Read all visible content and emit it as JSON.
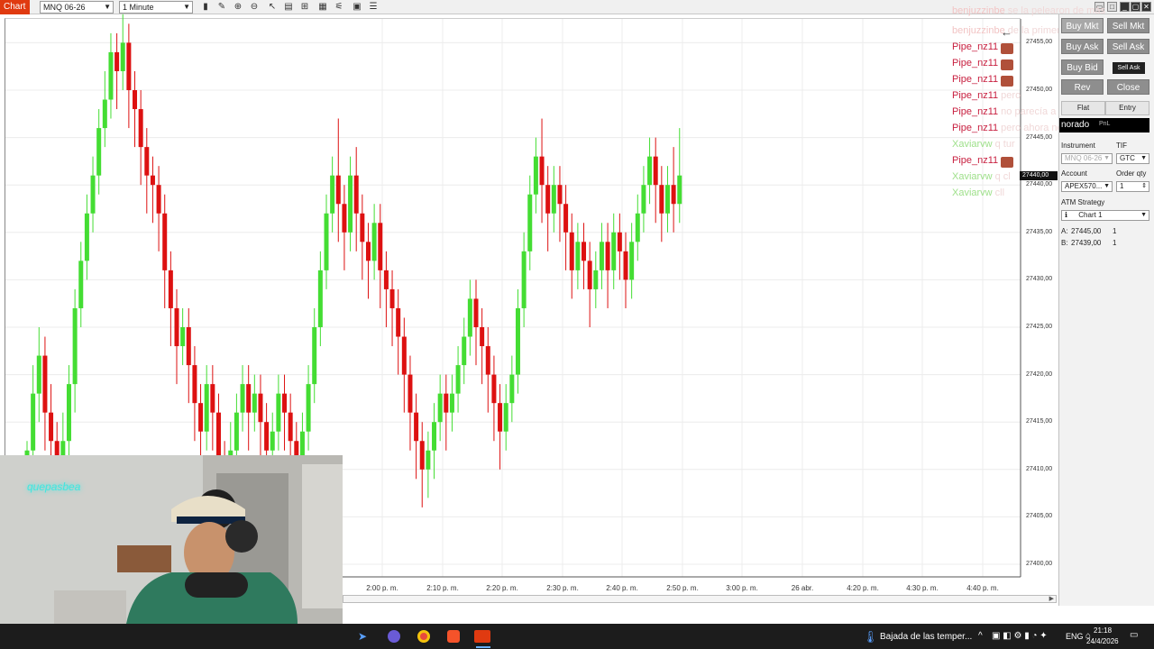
{
  "toolbar": {
    "tab": "Chart",
    "instrument": "MNQ 06-26",
    "interval": "1 Minute"
  },
  "price_axis": [
    "27455,00",
    "27450,00",
    "27445,00",
    "27440,00",
    "27435,00",
    "27430,00",
    "27425,00",
    "27420,00",
    "27415,00",
    "27410,00",
    "27405,00",
    "27400,00"
  ],
  "time_axis": [
    "2:00 p. m.",
    "2:10 p. m.",
    "2:20 p. m.",
    "2:30 p. m.",
    "2:40 p. m.",
    "2:50 p. m.",
    "3:00 p. m.",
    "26 abr.",
    "4:20 p. m.",
    "4:30 p. m.",
    "4:40 p. m."
  ],
  "price_tag": "27440,00",
  "chat": [
    {
      "user": "benjuzzinbe",
      "msg": "se la pelearon de más",
      "color": "#f2c4c4",
      "avatar": false
    },
    {
      "user": "benjuzzinbe",
      "msg": "de la primera de mierda",
      "color": "#f2c4c4",
      "avatar": false
    },
    {
      "user": "Pipe_nz11",
      "msg": "",
      "color": "#c82040",
      "avatar": true
    },
    {
      "user": "Pipe_nz11",
      "msg": "",
      "color": "#c82040",
      "avatar": true
    },
    {
      "user": "Pipe_nz11",
      "msg": "",
      "color": "#c82040",
      "avatar": true
    },
    {
      "user": "Pipe_nz11",
      "msg": "pero",
      "color": "#c82040",
      "avatar": false
    },
    {
      "user": "Pipe_nz11",
      "msg": "no parecía a ser",
      "color": "#c82040",
      "avatar": false
    },
    {
      "user": "Pipe_nz11",
      "msg": "pero ahora no",
      "color": "#c82040",
      "avatar": false
    },
    {
      "user": "Xaviarvw",
      "msg": "q tur",
      "color": "#9ee08a",
      "avatar": false
    },
    {
      "user": "Pipe_nz11",
      "msg": "",
      "color": "#c82040",
      "avatar": true
    },
    {
      "user": "Xaviarvw",
      "msg": "q cl",
      "color": "#9ee08a",
      "avatar": false
    },
    {
      "user": "Xaviarvw",
      "msg": "cll",
      "color": "#9ee08a",
      "avatar": false
    }
  ],
  "order_panel": {
    "buy_mkt": "Buy Mkt",
    "sell_mkt": "Sell Mkt",
    "buy_ask": "Buy Ask",
    "sell_ask": "Sell Ask",
    "buy_bid": "Buy Bid",
    "sell_ask_tooltip": "Sell Ask",
    "rev": "Rev",
    "close": "Close",
    "flat": "Flat",
    "entry": "Entry",
    "position_label": "norado",
    "pnl": "PnL",
    "instrument_label": "Instrument",
    "tif_label": "TIF",
    "instrument_value": "MNQ 06-26",
    "tif_value": "GTC",
    "account_label": "Account",
    "order_qty_label": "Order qty",
    "account_value": "APEX570...",
    "order_qty_value": "1",
    "atm_label": "ATM Strategy",
    "atm_value": "Chart 1",
    "ask_label": "A:",
    "ask_price": "27445,00",
    "ask_qty": "1",
    "bid_label": "B:",
    "bid_price": "27439,00",
    "bid_qty": "1"
  },
  "webcam": {
    "neon_text": "quepasbea"
  },
  "taskbar": {
    "weather": "Bajada de las temper...",
    "lang": "ENG",
    "time": "21:18",
    "date": "24/4/2026"
  },
  "chart_data": {
    "type": "candlestick",
    "instrument": "MNQ 06-26",
    "interval": "1 Minute",
    "ylim": [
      27400,
      27458
    ],
    "x_ticks": [
      "2:00 p. m.",
      "2:10 p. m.",
      "2:20 p. m.",
      "2:30 p. m.",
      "2:40 p. m.",
      "2:50 p. m.",
      "3:00 p. m.",
      "26 abr.",
      "4:20 p. m.",
      "4:30 p. m.",
      "4:40 p. m."
    ],
    "colors": {
      "up": "#44dd33",
      "down": "#dd1111"
    },
    "candles": [
      [
        27399,
        27412,
        27395,
        27413
      ],
      [
        27412,
        27418,
        27407,
        27421
      ],
      [
        27418,
        27422,
        27415,
        27425
      ],
      [
        27422,
        27416,
        27412,
        27424
      ],
      [
        27416,
        27413,
        27409,
        27419
      ],
      [
        27413,
        27409,
        27405,
        27415
      ],
      [
        27409,
        27413,
        27406,
        27416
      ],
      [
        27413,
        27419,
        27411,
        27421
      ],
      [
        27419,
        27427,
        27416,
        27429
      ],
      [
        27427,
        27432,
        27425,
        27434
      ],
      [
        27432,
        27437,
        27430,
        27439
      ],
      [
        27437,
        27441,
        27435,
        27443
      ],
      [
        27441,
        27446,
        27439,
        27448
      ],
      [
        27446,
        27449,
        27444,
        27452
      ],
      [
        27449,
        27454,
        27447,
        27456
      ],
      [
        27454,
        27452,
        27448,
        27456
      ],
      [
        27452,
        27455,
        27450,
        27458
      ],
      [
        27455,
        27450,
        27446,
        27457
      ],
      [
        27450,
        27448,
        27444,
        27452
      ],
      [
        27448,
        27444,
        27440,
        27450
      ],
      [
        27444,
        27441,
        27437,
        27446
      ],
      [
        27441,
        27440,
        27436,
        27443
      ],
      [
        27440,
        27437,
        27433,
        27442
      ],
      [
        27437,
        27431,
        27427,
        27439
      ],
      [
        27431,
        27427,
        27423,
        27433
      ],
      [
        27427,
        27423,
        27419,
        27429
      ],
      [
        27423,
        27425,
        27421,
        27427
      ],
      [
        27425,
        27421,
        27417,
        27427
      ],
      [
        27421,
        27417,
        27413,
        27423
      ],
      [
        27417,
        27414,
        27410,
        27419
      ],
      [
        27414,
        27419,
        27412,
        27421
      ],
      [
        27419,
        27416,
        27412,
        27421
      ],
      [
        27416,
        27411,
        27407,
        27418
      ],
      [
        27411,
        27408,
        27404,
        27413
      ],
      [
        27408,
        27412,
        27406,
        27415
      ],
      [
        27412,
        27416,
        27410,
        27418
      ],
      [
        27416,
        27419,
        27414,
        27421
      ],
      [
        27419,
        27416,
        27412,
        27421
      ],
      [
        27416,
        27418,
        27414,
        27420
      ],
      [
        27418,
        27415,
        27411,
        27420
      ],
      [
        27415,
        27412,
        27409,
        27417
      ],
      [
        27412,
        27414,
        27410,
        27416
      ],
      [
        27414,
        27418,
        27412,
        27420
      ],
      [
        27418,
        27416,
        27412,
        27420
      ],
      [
        27416,
        27413,
        27409,
        27418
      ],
      [
        27413,
        27410,
        27406,
        27415
      ],
      [
        27410,
        27414,
        27408,
        27416
      ],
      [
        27414,
        27419,
        27412,
        27421
      ],
      [
        27419,
        27425,
        27417,
        27427
      ],
      [
        27425,
        27431,
        27423,
        27433
      ],
      [
        27431,
        27437,
        27429,
        27439
      ],
      [
        27437,
        27441,
        27435,
        27443
      ],
      [
        27441,
        27438,
        27434,
        27447
      ],
      [
        27438,
        27435,
        27431,
        27440
      ],
      [
        27435,
        27441,
        27433,
        27443
      ],
      [
        27441,
        27437,
        27433,
        27444
      ],
      [
        27437,
        27434,
        27430,
        27439
      ],
      [
        27434,
        27432,
        27428,
        27436
      ],
      [
        27432,
        27436,
        27430,
        27438
      ],
      [
        27436,
        27431,
        27427,
        27438
      ],
      [
        27431,
        27429,
        27425,
        27433
      ],
      [
        27429,
        27427,
        27423,
        27431
      ],
      [
        27427,
        27424,
        27420,
        27429
      ],
      [
        27424,
        27420,
        27416,
        27426
      ],
      [
        27420,
        27416,
        27412,
        27422
      ],
      [
        27416,
        27413,
        27409,
        27418
      ],
      [
        27413,
        27410,
        27406,
        27415
      ],
      [
        27410,
        27412,
        27407,
        27414
      ],
      [
        27412,
        27415,
        27409,
        27417
      ],
      [
        27415,
        27418,
        27413,
        27420
      ],
      [
        27418,
        27416,
        27412,
        27420
      ],
      [
        27416,
        27418,
        27414,
        27420
      ],
      [
        27418,
        27421,
        27416,
        27423
      ],
      [
        27421,
        27424,
        27419,
        27426
      ],
      [
        27424,
        27428,
        27422,
        27430
      ],
      [
        27428,
        27425,
        27421,
        27430
      ],
      [
        27425,
        27423,
        27419,
        27427
      ],
      [
        27423,
        27420,
        27416,
        27425
      ],
      [
        27420,
        27417,
        27413,
        27422
      ],
      [
        27417,
        27414,
        27410,
        27419
      ],
      [
        27414,
        27417,
        27412,
        27419
      ],
      [
        27417,
        27420,
        27415,
        27422
      ],
      [
        27420,
        27427,
        27418,
        27429
      ],
      [
        27427,
        27433,
        27425,
        27435
      ],
      [
        27433,
        27439,
        27431,
        27441
      ],
      [
        27439,
        27443,
        27437,
        27445
      ],
      [
        27443,
        27440,
        27436,
        27447
      ],
      [
        27440,
        27437,
        27433,
        27442
      ],
      [
        27437,
        27440,
        27435,
        27442
      ],
      [
        27440,
        27438,
        27434,
        27442
      ],
      [
        27438,
        27435,
        27431,
        27440
      ],
      [
        27435,
        27431,
        27428,
        27437
      ],
      [
        27431,
        27434,
        27429,
        27436
      ],
      [
        27434,
        27432,
        27429,
        27436
      ],
      [
        27432,
        27429,
        27425,
        27434
      ],
      [
        27429,
        27431,
        27427,
        27433
      ],
      [
        27431,
        27434,
        27429,
        27436
      ],
      [
        27434,
        27431,
        27427,
        27436
      ],
      [
        27431,
        27435,
        27429,
        27437
      ],
      [
        27435,
        27433,
        27430,
        27437
      ],
      [
        27433,
        27430,
        27427,
        27435
      ],
      [
        27430,
        27434,
        27428,
        27436
      ],
      [
        27434,
        27437,
        27432,
        27439
      ],
      [
        27437,
        27440,
        27435,
        27442
      ],
      [
        27440,
        27443,
        27438,
        27445
      ],
      [
        27443,
        27440,
        27436,
        27445
      ],
      [
        27440,
        27437,
        27434,
        27442
      ],
      [
        27437,
        27440,
        27435,
        27442
      ],
      [
        27440,
        27438,
        27435,
        27444
      ],
      [
        27438,
        27441,
        27436,
        27446
      ]
    ]
  }
}
